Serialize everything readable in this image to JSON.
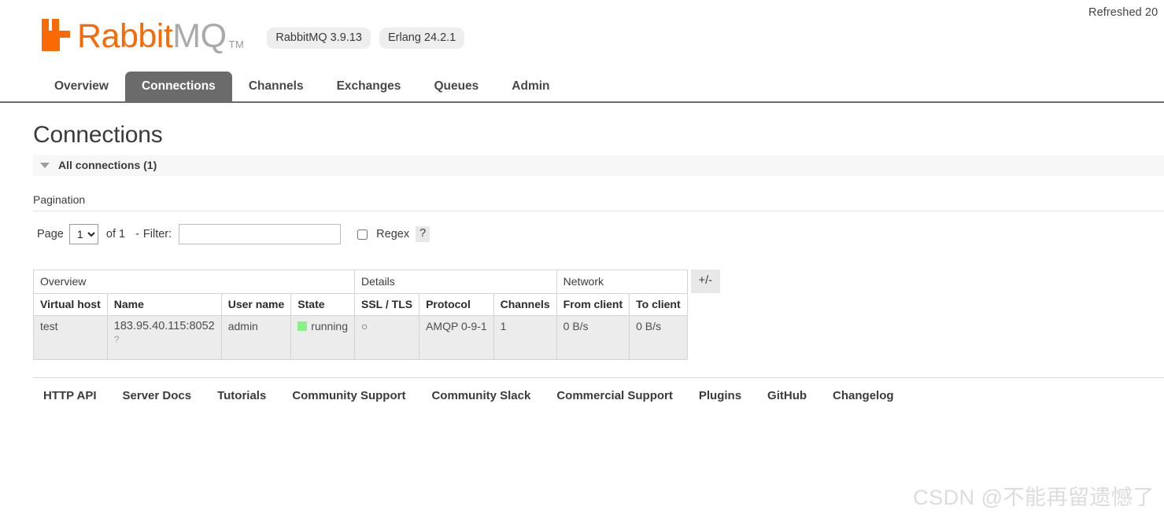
{
  "refresh": {
    "status_text": "Refreshed 20"
  },
  "header": {
    "logo": {
      "brand_primary": "Rabbit",
      "brand_secondary": "MQ",
      "trademark": "TM",
      "color_primary": "#f96a07",
      "color_secondary": "#aaaaaa"
    },
    "badges": [
      {
        "label": "RabbitMQ 3.9.13"
      },
      {
        "label": "Erlang 24.2.1"
      }
    ]
  },
  "nav": {
    "tabs": [
      {
        "label": "Overview",
        "active": false
      },
      {
        "label": "Connections",
        "active": true
      },
      {
        "label": "Channels",
        "active": false
      },
      {
        "label": "Exchanges",
        "active": false
      },
      {
        "label": "Queues",
        "active": false
      },
      {
        "label": "Admin",
        "active": false
      }
    ],
    "active_tab_bg": "#6b6b6b"
  },
  "page": {
    "title": "Connections",
    "section": {
      "label": "All connections (1)",
      "expanded": true
    }
  },
  "pagination": {
    "heading": "Pagination",
    "page_word": "Page",
    "page_value": "1",
    "page_options": [
      "1"
    ],
    "of_text": "of 1",
    "separator": "-",
    "filter_label": "Filter:",
    "filter_value": "",
    "filter_placeholder": "",
    "regex_label": "Regex",
    "regex_checked": false,
    "help_label": "?"
  },
  "table": {
    "groups": [
      {
        "label": "Overview",
        "colspan": 4
      },
      {
        "label": "Details",
        "colspan": 3
      },
      {
        "label": "Network",
        "colspan": 2
      }
    ],
    "columns": [
      "Virtual host",
      "Name",
      "User name",
      "State",
      "SSL / TLS",
      "Protocol",
      "Channels",
      "From client",
      "To client"
    ],
    "rows": [
      {
        "virtual_host": "test",
        "name": "183.95.40.115:8052",
        "name_help": "?",
        "user_name": "admin",
        "state": "running",
        "state_color": "#8bf08b",
        "ssl_tls": "○",
        "protocol": "AMQP 0-9-1",
        "channels": "1",
        "from_client": "0 B/s",
        "to_client": "0 B/s"
      }
    ],
    "toggle_columns_label": "+/-"
  },
  "footer": {
    "links": [
      {
        "label": "HTTP API"
      },
      {
        "label": "Server Docs"
      },
      {
        "label": "Tutorials"
      },
      {
        "label": "Community Support"
      },
      {
        "label": "Community Slack"
      },
      {
        "label": "Commercial Support"
      },
      {
        "label": "Plugins"
      },
      {
        "label": "GitHub"
      },
      {
        "label": "Changelog"
      }
    ]
  },
  "watermark": {
    "text": "CSDN @不能再留遗憾了"
  }
}
